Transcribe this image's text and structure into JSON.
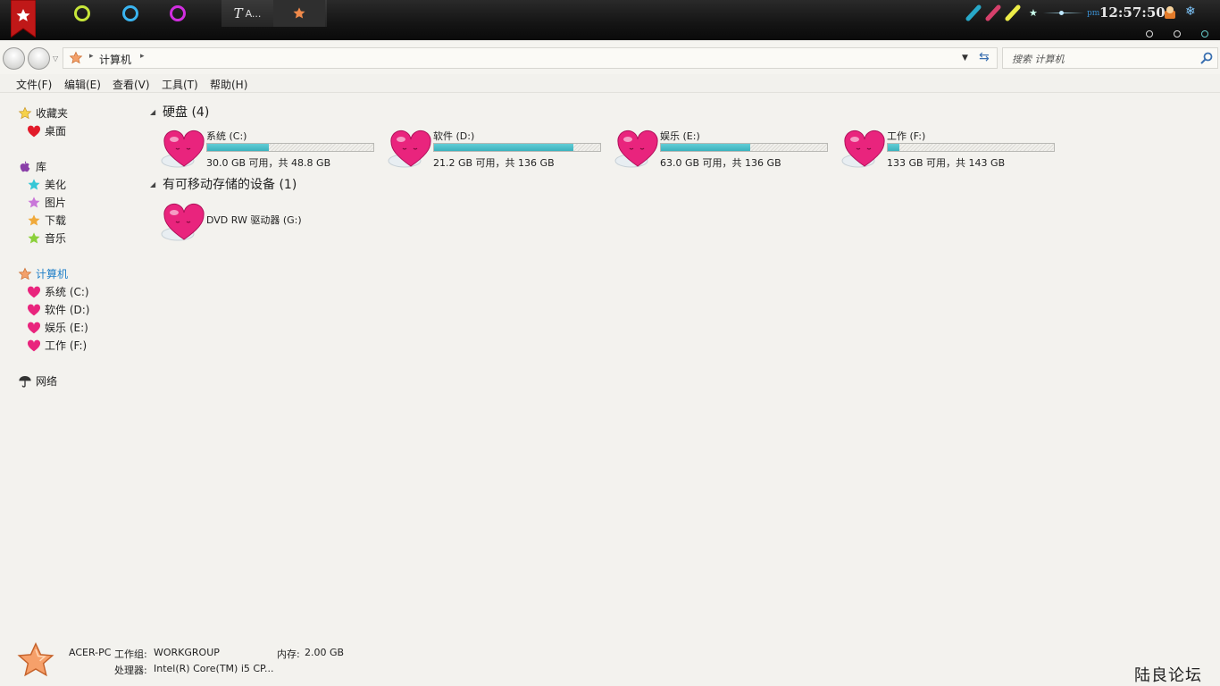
{
  "taskbar": {
    "active_task_label": "A...",
    "clock_ampm": "pm",
    "clock_time": "12:57:50"
  },
  "address": {
    "breadcrumb": "计算机",
    "search_placeholder": "搜索 计算机"
  },
  "menu": [
    "文件(F)",
    "编辑(E)",
    "查看(V)",
    "工具(T)",
    "帮助(H)"
  ],
  "sidebar": {
    "favorites": {
      "label": "收藏夹",
      "items": [
        {
          "label": "桌面"
        }
      ]
    },
    "libraries": {
      "label": "库",
      "items": [
        {
          "label": "美化",
          "color": "#35c7d6"
        },
        {
          "label": "图片",
          "color": "#c976d9"
        },
        {
          "label": "下载",
          "color": "#f0a93a"
        },
        {
          "label": "音乐",
          "color": "#8bd03a"
        }
      ]
    },
    "computer": {
      "label": "计算机",
      "items": [
        {
          "label": "系统 (C:)"
        },
        {
          "label": "软件 (D:)"
        },
        {
          "label": "娱乐 (E:)"
        },
        {
          "label": "工作 (F:)"
        }
      ]
    },
    "network": {
      "label": "网络"
    }
  },
  "main": {
    "hard_disks": {
      "title": "硬盘 (4)",
      "drives": [
        {
          "name": "系统 (C:)",
          "info": "30.0 GB 可用，共 48.8 GB",
          "used_fraction": 0.37
        },
        {
          "name": "软件 (D:)",
          "info": "21.2 GB 可用，共 136 GB",
          "used_fraction": 0.84
        },
        {
          "name": "娱乐 (E:)",
          "info": "63.0 GB 可用，共 136 GB",
          "used_fraction": 0.54
        },
        {
          "name": "工作 (F:)",
          "info": "133 GB 可用，共 143 GB",
          "used_fraction": 0.07
        }
      ]
    },
    "removable": {
      "title": "有可移动存储的设备 (1)",
      "devices": [
        {
          "name": "DVD RW 驱动器 (G:)"
        }
      ]
    }
  },
  "details": {
    "pc_name": "ACER-PC",
    "workgroup_label": "工作组:",
    "workgroup_value": "WORKGROUP",
    "memory_label": "内存:",
    "memory_value": "2.00 GB",
    "processor_label": "处理器:",
    "processor_value": "Intel(R) Core(TM) i5 CP..."
  },
  "watermark": "陆良论坛",
  "colors": {
    "accent": "#1f7fc8",
    "bar_fill": "#45bec8",
    "heart": "#e9247d"
  }
}
